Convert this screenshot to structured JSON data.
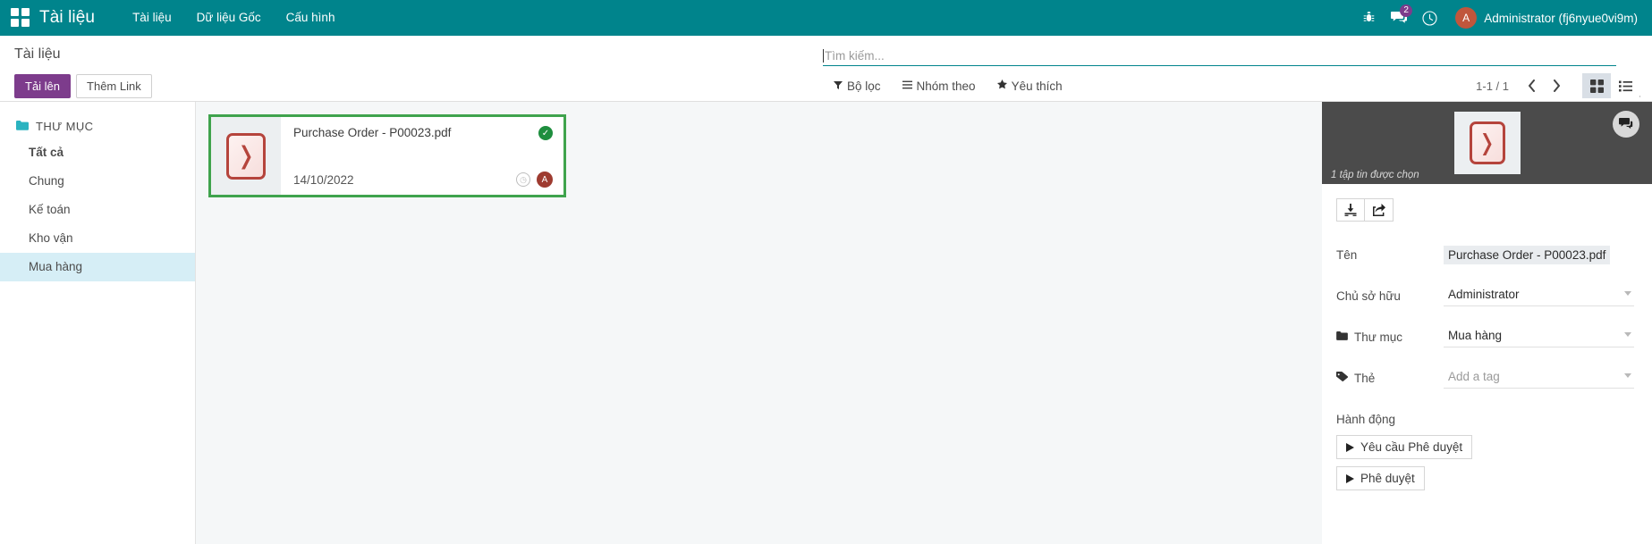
{
  "navbar": {
    "apps_icon": "apps-grid-icon",
    "brand": "Tài liệu",
    "menu_items": [
      {
        "label": "Tài liệu"
      },
      {
        "label": "Dữ liệu Gốc"
      },
      {
        "label": "Cấu hình"
      }
    ],
    "icons": {
      "debug": "bug-icon",
      "messages": "chat-icon",
      "activities": "clock-icon"
    },
    "message_count": "2",
    "user": {
      "initial": "A",
      "name": "Administrator (fj6nyue0vi9m)"
    },
    "accent_color": "#00848c"
  },
  "control_panel": {
    "breadcrumb": "Tài liệu",
    "buttons": {
      "upload": "Tải lên",
      "add_link": "Thêm Link"
    },
    "search": {
      "placeholder": "Tìm kiếm...",
      "value": "",
      "icon": "search-icon"
    },
    "filters": [
      {
        "label": "Bộ lọc",
        "icon": "filter-icon"
      },
      {
        "label": "Nhóm theo",
        "icon": "list-icon"
      },
      {
        "label": "Yêu thích",
        "icon": "star-icon"
      }
    ],
    "pager": {
      "count": "1-1 / 1",
      "prev_icon": "chevron-left-icon",
      "next_icon": "chevron-right-icon"
    },
    "view_switcher": {
      "kanban": "kanban-view-icon",
      "list": "list-view-icon",
      "active": "kanban"
    },
    "primary_color": "#7d3c8c"
  },
  "sidebar": {
    "section_title": "THƯ MỤC",
    "section_icon": "folder-icon",
    "items": [
      {
        "label": "Tất cả",
        "bold": true,
        "selected": false
      },
      {
        "label": "Chung",
        "bold": false,
        "selected": false
      },
      {
        "label": "Kế toán",
        "bold": false,
        "selected": false
      },
      {
        "label": "Kho vận",
        "bold": false,
        "selected": false
      },
      {
        "label": "Mua hàng",
        "bold": false,
        "selected": true
      }
    ]
  },
  "kanban": {
    "cards": [
      {
        "name": "Purchase Order - P00023.pdf",
        "date": "14/10/2022",
        "file_icon": "pdf-file-icon",
        "status_icon": "check-circle-icon",
        "activity_icon": "clock-icon",
        "owner_initial": "A",
        "selected": true,
        "selected_color": "#3fa34d"
      }
    ]
  },
  "inspector": {
    "preview": {
      "file_icon": "pdf-file-icon",
      "caption": "1 tập tin được chọn",
      "chat_icon": "chat-bubble-icon"
    },
    "toolbar": [
      {
        "icon": "download-icon",
        "name": "download-button"
      },
      {
        "icon": "share-icon",
        "name": "share-button"
      }
    ],
    "fields": [
      {
        "label": "Tên",
        "value": "Purchase Order - P00023.pdf",
        "style": "highlight",
        "icon": null
      },
      {
        "label": "Chủ sở hữu",
        "value": "Administrator",
        "style": "select",
        "icon": null
      },
      {
        "label": "Thư mục",
        "value": "Mua hàng",
        "style": "select",
        "icon": "folder-icon"
      },
      {
        "label": "Thẻ",
        "value": "Add a tag",
        "style": "select-placeholder",
        "icon": "tag-icon"
      }
    ],
    "actions_title": "Hành động",
    "actions": [
      {
        "label": "Yêu cầu Phê duyệt"
      },
      {
        "label": "Phê duyệt"
      }
    ]
  }
}
